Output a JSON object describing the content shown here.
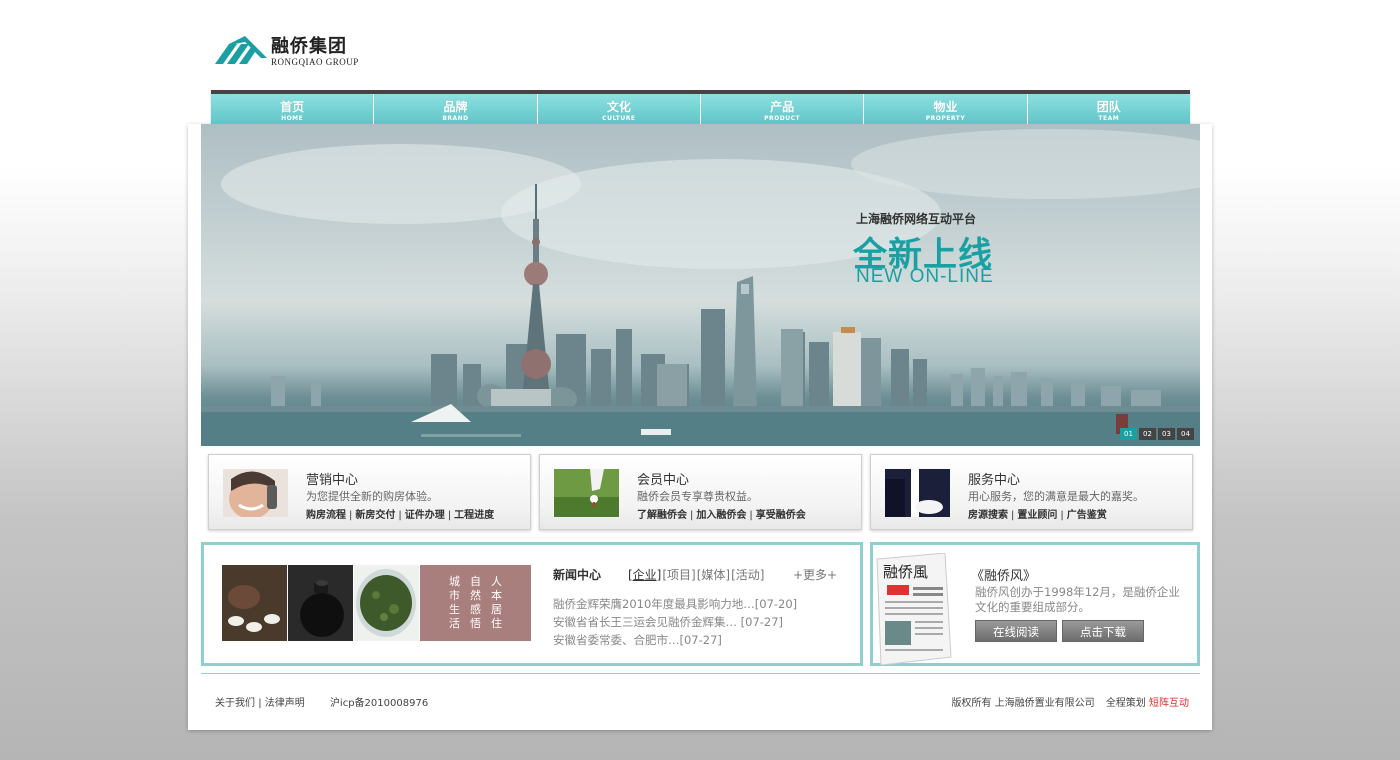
{
  "logo": {
    "cn": "融侨集团",
    "en": "RONGQIAO GROUP"
  },
  "nav": [
    {
      "cn": "首页",
      "en": "HOME"
    },
    {
      "cn": "品牌",
      "en": "BRAND"
    },
    {
      "cn": "文化",
      "en": "CULTURE"
    },
    {
      "cn": "产品",
      "en": "PRODUCT"
    },
    {
      "cn": "物业",
      "en": "PROPERTY"
    },
    {
      "cn": "团队",
      "en": "TEAM"
    }
  ],
  "banner": {
    "subtitle": "上海融侨网络互动平台",
    "title": "全新上线",
    "title_en": "NEW ON-LINE",
    "slides": [
      "01",
      "02",
      "03",
      "04"
    ],
    "active_slide": 0
  },
  "services": [
    {
      "title": "营销中心",
      "desc": "为您提供全新的购房体验。",
      "links": [
        "购房流程",
        "新房交付",
        "证件办理",
        "工程进度"
      ]
    },
    {
      "title": "会员中心",
      "desc": "融侨会员专享尊贵权益。",
      "links": [
        "了解融侨会",
        "加入融侨会",
        "享受融侨会"
      ]
    },
    {
      "title": "服务中心",
      "desc": "用心服务，您的满意是最大的嘉奖。",
      "links": [
        "房源搜索",
        "置业顾问",
        "广告鉴赏"
      ]
    }
  ],
  "motto": {
    "columns": [
      "城市生活",
      "自然感悟",
      "人本居住"
    ]
  },
  "news": {
    "heading": "新闻中心",
    "tabs": [
      "[企业]",
      "[项目]",
      "[媒体]",
      "[活动]"
    ],
    "active_tab": 0,
    "more": "+更多+",
    "items": [
      "融侨金辉荣膺2010年度最具影响力地…[07-20]",
      "安徽省省长王三运会见融侨金辉集… [07-27]",
      "安徽省委常委、合肥市…[07-27]"
    ]
  },
  "magazine": {
    "title": "《融侨风》",
    "desc": "融侨风创办于1998年12月，是融侨企业文化的重要组成部分。",
    "read_btn": "在线阅读",
    "download_btn": "点击下载",
    "cover_title": "融侨風"
  },
  "footer": {
    "about": "关于我们",
    "legal": "法律声明",
    "icp": "沪icp备2010008976",
    "copyright": "版权所有 上海融侨置业有限公司",
    "planner_label": "全程策划",
    "planner": "短阵互动"
  },
  "colors": {
    "accent": "#1aa0a3",
    "nav": "#72d0d2",
    "border": "#8fcfcf",
    "motto": "#a97f7d",
    "footer_brand": "#e03030"
  }
}
